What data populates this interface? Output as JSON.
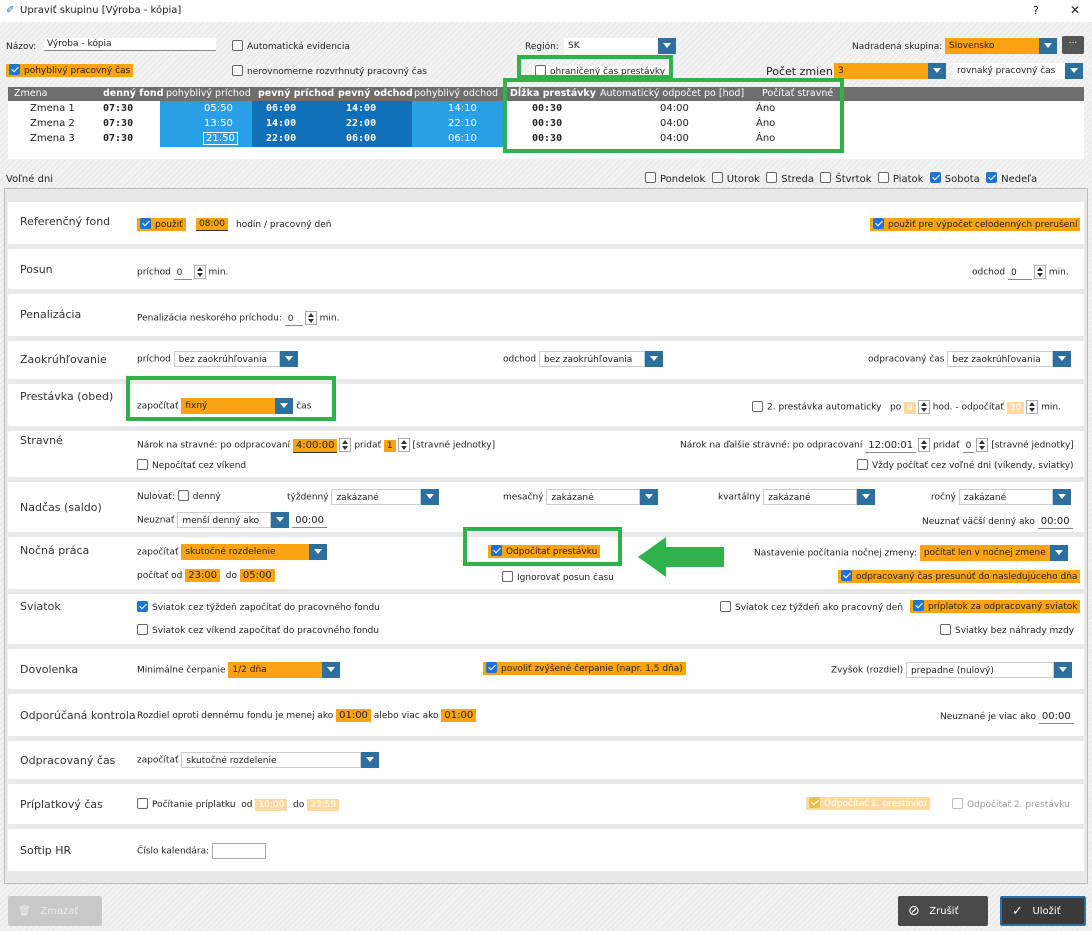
{
  "window": {
    "title": "Upraviť skupinu [Výroba - kópia]",
    "help": "?",
    "close": "✕"
  },
  "top": {
    "name_label": "Názov:",
    "name_value": "Výroba - kópia",
    "auto_evid": "Automatická evidencia",
    "region_label": "Región:",
    "region_value": "SK",
    "parent_label": "Nadradená skupina:",
    "parent_value": "Slovensko",
    "more": "...",
    "flex_time": "pohyblivý pracovný čas",
    "uneven": "nerovnomerne rozvrhnutý pracovný čas",
    "limited_break": "ohraničený čas prestávky",
    "shifts_label": "Počet zmien",
    "shifts_value": "3",
    "same_time": "rovnaký pracovný čas"
  },
  "shift_table": {
    "headers": [
      "Zmena",
      "denný fond",
      "pohyblivý príchod",
      "pevný príchod",
      "pevný odchod",
      "pohyblivý odchod",
      "Dĺžka prestávky",
      "Automatický odpočet po [hod]",
      "Počítať stravné"
    ],
    "rows": [
      [
        "Zmena 1",
        "07:30",
        "05:50",
        "06:00",
        "14:00",
        "14:10",
        "00:30",
        "04:00",
        "Áno"
      ],
      [
        "Zmena 2",
        "07:30",
        "13:50",
        "14:00",
        "22:00",
        "22:10",
        "00:30",
        "04:00",
        "Áno"
      ],
      [
        "Zmena 3",
        "07:30",
        "21:50",
        "22:00",
        "06:00",
        "06:10",
        "00:30",
        "04:00",
        "Áno"
      ]
    ]
  },
  "free_days": {
    "label": "Voľné dni",
    "days": [
      "Pondelok",
      "Utorok",
      "Streda",
      "Štvrtok",
      "Piatok",
      "Sobota",
      "Nedeľa"
    ]
  },
  "ref": {
    "label": "Referenčný fond",
    "use": "použiť",
    "hours": "08:00",
    "unit": "hodín / pracovný deň",
    "use_calc": "použiť pre výpočet celodenných prerušení"
  },
  "posun": {
    "label": "Posun",
    "arrival": "príchod",
    "arrival_val": "0",
    "min": "min.",
    "departure": "odchod",
    "departure_val": "0"
  },
  "penal": {
    "label": "Penalizácia",
    "text": "Penalizácia neskorého príchodu:",
    "val": "0",
    "min": "min."
  },
  "round": {
    "label": "Zaokrúhľovanie",
    "arrival": "príchod",
    "departure": "odchod",
    "worked": "odpracovaný čas",
    "value": "bez zaokrúhľovania"
  },
  "break": {
    "label": "Prestávka (obed)",
    "count": "započítať",
    "value": "fixný",
    "time": "čas",
    "second": "2. prestávka automaticky",
    "after": "po",
    "after_val": "8",
    "hod": "hod. - odpočítať",
    "deduct": "30",
    "min": "min."
  },
  "meal": {
    "label": "Stravné",
    "claim": "Nárok na stravné: po odpracovaní",
    "claim_val": "4:00:00",
    "add": "pridať",
    "add_val": "1",
    "units": "[stravné jednotky]",
    "next": "Nárok na ďalšie stravné: po odpracovaní",
    "next_val": "12:00:01",
    "add2_val": "0",
    "no_weekend": "Nepočítať cez víkend",
    "always": "Vždy počítať cez voľné dni (víkendy, sviatky)"
  },
  "overtime": {
    "label": "Nadčas (saldo)",
    "reset": "Nulovať:",
    "daily": "denný",
    "weekly": "týždenný",
    "weekly_val": "zakázané",
    "monthly": "mesačný",
    "monthly_val": "zakázané",
    "quarterly": "kvartálny",
    "quarterly_val": "zakázané",
    "yearly": "ročný",
    "yearly_val": "zakázané",
    "ignore": "Neuznať",
    "ignore_val": "menší denný ako",
    "ignore_time": "00:00",
    "ignore_bigger": "Neuznať väčší denný ako",
    "ignore_bigger_time": "00:00"
  },
  "night": {
    "label": "Nočná práca",
    "count": "započítať",
    "count_val": "skutočné rozdelenie",
    "deduct": "Odpočítať prestávku",
    "ignore_shift": "Ignorovať posun času",
    "setting": "Nastavenie počítania nočnej zmeny:",
    "setting_val": "počítať len v nočnej zmene",
    "from": "počítať od",
    "from_val": "23:00",
    "to": "do",
    "to_val": "05:00",
    "move": "odpracovaný čas presunúť do nasledujúceho dňa"
  },
  "holiday": {
    "label": "Sviatok",
    "week": "Sviatok cez týždeň započítať do pracovného fondu",
    "weekend": "Sviatok cez víkend započítať do pracovného fondu",
    "as_work": "Sviatok cez týždeň ako pracovný deň",
    "bonus": "príplatok za odpracovaný sviatok",
    "no_comp": "Sviatky bez náhrady mzdy"
  },
  "vacation": {
    "label": "Dovolenka",
    "min": "Minimálne čerpanie",
    "min_val": "1/2 dňa",
    "allow": "povoliť zvýšené čerpanie (napr. 1,5 dňa)",
    "rest": "Zvyšok (rozdiel)",
    "rest_val": "prepadne (nulový)"
  },
  "control": {
    "label": "Odporúčaná kontrola",
    "text": "Rozdiel oproti dennému fondu je menej ako",
    "less": "01:00",
    "or": "alebo viac ako",
    "more": "01:00",
    "unrec": "Neuznané je viac ako",
    "unrec_val": "00:00"
  },
  "worked": {
    "label": "Odpracovaný čas",
    "count": "započítať",
    "val": "skutočné rozdelenie"
  },
  "extra": {
    "label": "Príplatkový čas",
    "calc": "Počítanie príplatku",
    "from": "od",
    "from_val": "10:00",
    "to": "do",
    "to_val": "23:59",
    "deduct1": "Odpočítať 1. prestávku",
    "deduct2": "Odpočítať 2. prestávku"
  },
  "softip": {
    "label": "Softip HR",
    "cal": "Číslo kalendára:"
  },
  "footer": {
    "delete": "Zmazať",
    "cancel": "Zrušiť",
    "save": "Uložiť"
  }
}
